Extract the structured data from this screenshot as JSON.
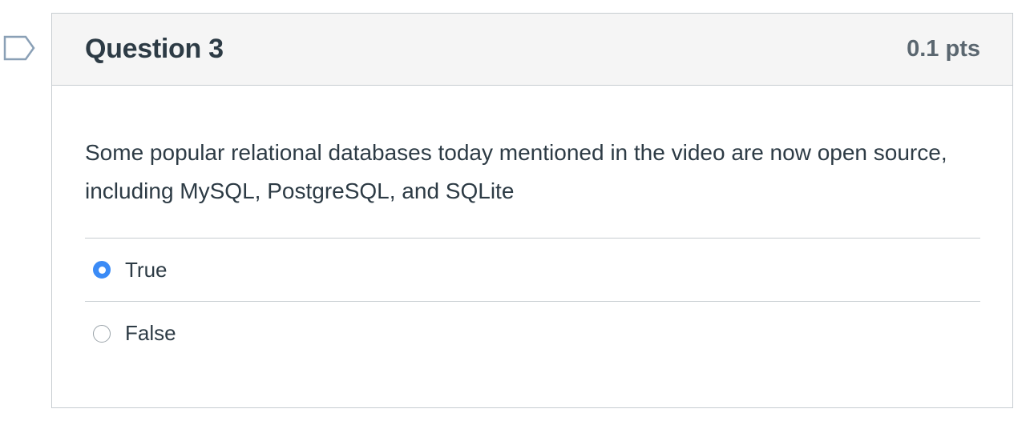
{
  "question": {
    "title": "Question 3",
    "points": "0.1 pts",
    "text": "Some popular relational databases today mentioned in the video are now open source, including MySQL, PostgreSQL, and SQLite"
  },
  "answers": [
    {
      "label": "True",
      "selected": true
    },
    {
      "label": "False",
      "selected": false
    }
  ],
  "colors": {
    "accent": "#3b8bf6",
    "header_bg": "#f5f5f5",
    "border": "#c7cdd1",
    "text": "#2d3b45",
    "points_text": "#5b6770"
  },
  "icons": {
    "flag": "bookmark-flag-icon"
  }
}
